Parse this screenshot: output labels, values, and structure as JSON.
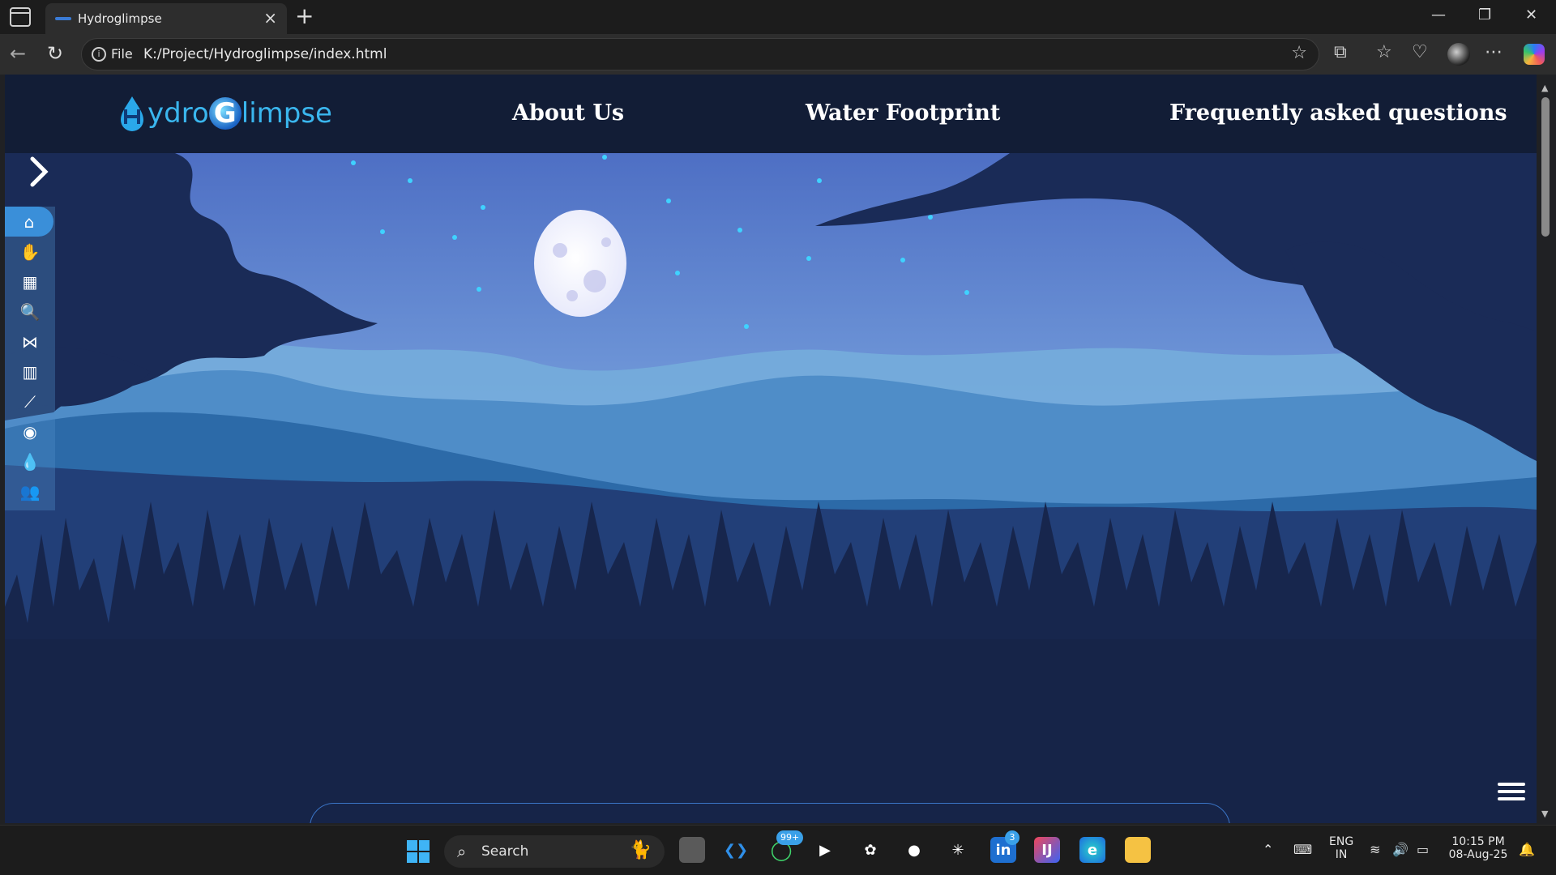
{
  "browser": {
    "tab_title": "Hydroglimpse",
    "address_prefix": "File",
    "url": "K:/Project/Hydroglimpse/index.html"
  },
  "site": {
    "logo_text_left": "ydro",
    "logo_g": "G",
    "logo_text_right": "limpse",
    "nav": {
      "about": "About Us",
      "water_footprint": "Water Footprint",
      "faq": "Frequently asked questions"
    },
    "sidebar_icons": [
      "home-icon",
      "hand-holding-water-icon",
      "calculator-icon",
      "search-chart-icon",
      "network-icon",
      "bar-chart-icon",
      "line-chart-icon",
      "target-icon",
      "water-drop-icon",
      "users-icon"
    ]
  },
  "taskbar": {
    "search_label": "Search",
    "whatsapp_badge": "99+",
    "linkedin_badge": "3",
    "language_top": "ENG",
    "language_bottom": "IN",
    "time": "10:15 PM",
    "date": "08-Aug-25"
  },
  "colors": {
    "header_bg": "#121d36",
    "sky_top": "#4e6fc4",
    "sky_bottom": "#8fbfe3",
    "accent": "#3a8fd9"
  }
}
